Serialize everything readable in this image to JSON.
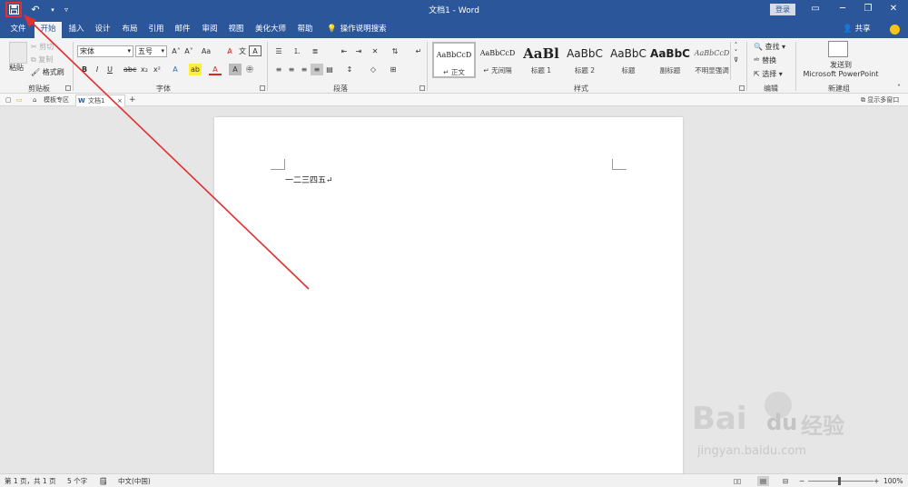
{
  "titlebar": {
    "title": "文档1 - Word",
    "login": "登录",
    "colors": {
      "bar": "#2b579a",
      "highlight": "#e03030"
    }
  },
  "qat": {
    "save_icon": "save-icon",
    "undo_icon": "undo-icon",
    "customize_icon": "customize-qat-icon"
  },
  "tabs": [
    {
      "label": "文件"
    },
    {
      "label": "开始"
    },
    {
      "label": "插入"
    },
    {
      "label": "设计"
    },
    {
      "label": "布局"
    },
    {
      "label": "引用"
    },
    {
      "label": "邮件"
    },
    {
      "label": "审阅"
    },
    {
      "label": "视图"
    },
    {
      "label": "美化大师"
    },
    {
      "label": "帮助"
    }
  ],
  "tellme": {
    "label": "操作说明搜索"
  },
  "share": {
    "label": "共享"
  },
  "ribbon": {
    "clipboard": {
      "paste": "粘贴",
      "cut": "剪切",
      "copy": "复制",
      "format_painter": "格式刷",
      "label": "剪贴板"
    },
    "font": {
      "name": "宋体",
      "size": "五号",
      "label": "字体"
    },
    "paragraph": {
      "label": "段落"
    },
    "styles": {
      "label": "样式",
      "items": [
        {
          "sample": "AaBbCcD",
          "name": "↵ 正文"
        },
        {
          "sample": "AaBbCcD",
          "name": "↵ 无间隔"
        },
        {
          "sample": "AaBl",
          "name": "标题 1"
        },
        {
          "sample": "AaBbC",
          "name": "标题 2"
        },
        {
          "sample": "AaBbC",
          "name": "标题"
        },
        {
          "sample": "AaBbC",
          "name": "副标题"
        },
        {
          "sample": "AaBbCcD",
          "name": "不明显强调"
        }
      ]
    },
    "editing": {
      "find": "查找",
      "replace": "替换",
      "select": "选择",
      "label": "编辑"
    },
    "newgroup": {
      "send_line1": "发送到",
      "send_line2": "Microsoft PowerPoint",
      "label": "新建组"
    }
  },
  "navstrip": {
    "templates": "模板专区",
    "doc_tab": "文档1",
    "multi": "显示多窗口"
  },
  "document": {
    "text": "一二三四五↵"
  },
  "statusbar": {
    "page": "第 1 页，共 1 页",
    "words": "5 个字",
    "language": "中文(中国)",
    "zoom": "100%"
  },
  "watermark": {
    "brand": "Bai",
    "brand2": "du",
    "cn": "经验",
    "url": "jingyan.baidu.com"
  }
}
